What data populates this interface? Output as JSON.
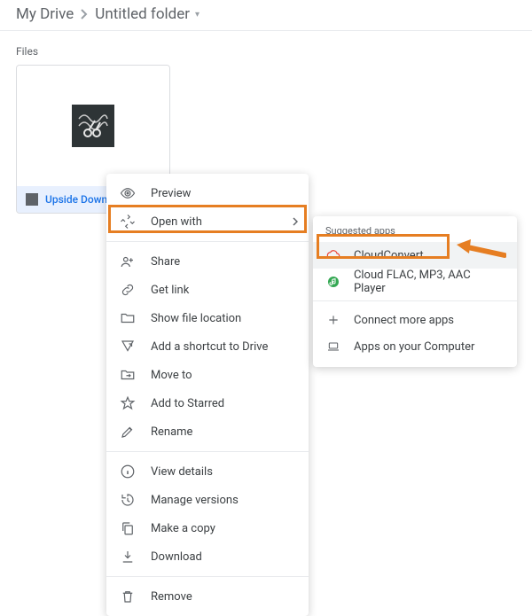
{
  "breadcrumb": {
    "root": "My Drive",
    "folder": "Untitled folder"
  },
  "section_label": "Files",
  "file": {
    "name": "Upside Down"
  },
  "menu": {
    "preview": "Preview",
    "open_with": "Open with",
    "share": "Share",
    "get_link": "Get link",
    "show_location": "Show file location",
    "add_shortcut": "Add a shortcut to Drive",
    "move_to": "Move to",
    "add_starred": "Add to Starred",
    "rename": "Rename",
    "view_details": "View details",
    "manage_versions": "Manage versions",
    "make_copy": "Make a copy",
    "download": "Download",
    "remove": "Remove"
  },
  "submenu": {
    "suggested_label": "Suggested apps",
    "cloudconvert": "CloudConvert",
    "flac_player": "Cloud FLAC, MP3, AAC Player",
    "connect_more": "Connect more apps",
    "apps_computer": "Apps on your Computer"
  }
}
